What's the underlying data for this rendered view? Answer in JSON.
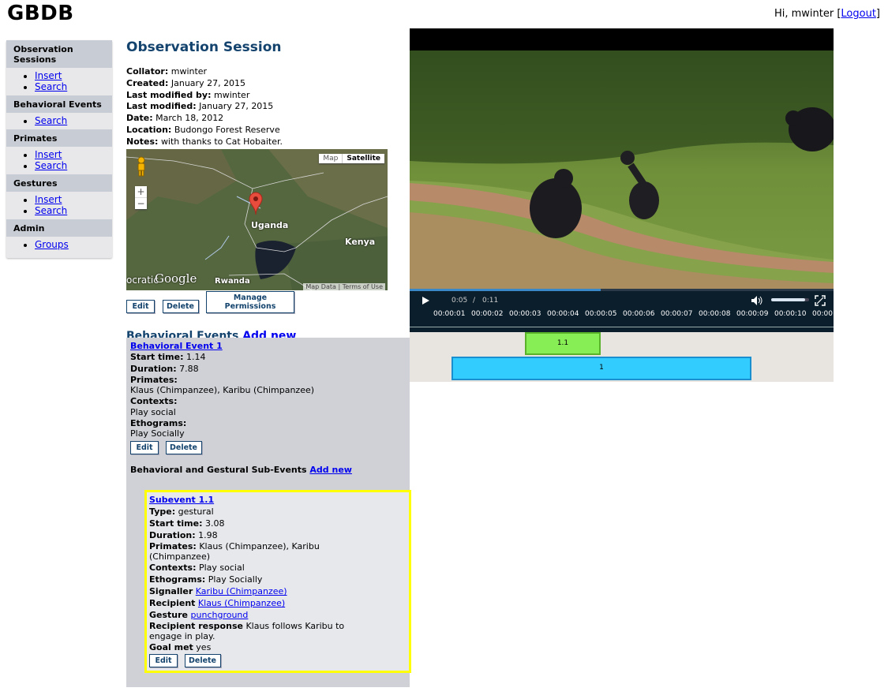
{
  "brand": "GBDB",
  "user": {
    "greeting": "Hi, mwinter [",
    "logout": "Logout",
    "close": "]"
  },
  "sidebar": {
    "sections": [
      {
        "title": "Observation Sessions",
        "items": [
          "Insert",
          "Search"
        ]
      },
      {
        "title": "Behavioral Events",
        "items": [
          "Search"
        ]
      },
      {
        "title": "Primates",
        "items": [
          "Insert",
          "Search"
        ]
      },
      {
        "title": "Gestures",
        "items": [
          "Insert",
          "Search"
        ]
      },
      {
        "title": "Admin",
        "items": [
          "Groups"
        ]
      }
    ]
  },
  "session": {
    "title": "Observation Session",
    "fields": [
      {
        "label": "Collator:",
        "value": "mwinter"
      },
      {
        "label": "Created:",
        "value": "January 27, 2015"
      },
      {
        "label": "Last modified by:",
        "value": "mwinter"
      },
      {
        "label": "Last modified:",
        "value": "January 27, 2015"
      },
      {
        "label": "Date:",
        "value": "March 18, 2012"
      },
      {
        "label": "Location:",
        "value": "Budongo Forest Reserve"
      },
      {
        "label": "Notes:",
        "value": "with thanks to Cat Hobaiter."
      }
    ],
    "map": {
      "type_map": "Map",
      "type_satellite": "Satellite",
      "zoom_in": "+",
      "zoom_out": "−",
      "label_uganda": "Uganda",
      "label_kenya": "Kenya",
      "label_rwanda": "Rwanda",
      "google": "Google",
      "google_prefix": "ocratic",
      "map_data": "Map Data",
      "terms": "Terms of Use"
    },
    "buttons": {
      "edit": "Edit",
      "delete": "Delete",
      "permissions": "Manage Permissions"
    }
  },
  "events": {
    "title": "Behavioral Events",
    "add_new": "Add new",
    "event": {
      "name": "Behavioral Event 1",
      "start_label": "Start time:",
      "start": "1.14",
      "duration_label": "Duration:",
      "duration": "7.88",
      "primates_label": "Primates:",
      "primates": "Klaus (Chimpanzee), Karibu (Chimpanzee)",
      "contexts_label": "Contexts:",
      "contexts": "Play social",
      "ethograms_label": "Ethograms:",
      "ethograms": "Play Socially",
      "edit": "Edit",
      "delete": "Delete"
    },
    "sub_title": "Behavioral and Gestural Sub-Events",
    "sub_add_new": "Add new",
    "subevent": {
      "name": "Subevent 1.1",
      "type_label": "Type:",
      "type": "gestural",
      "start_label": "Start time:",
      "start": "3.08",
      "duration_label": "Duration:",
      "duration": "1.98",
      "primates_label": "Primates:",
      "primates": "Klaus (Chimpanzee), Karibu (Chimpanzee)",
      "contexts_label": "Contexts:",
      "contexts": "Play social",
      "ethograms_label": "Ethograms:",
      "ethograms": "Play Socially",
      "signaller_label": "Signaller",
      "signaller": "Karibu (Chimpanzee)",
      "recipient_label": "Recipient",
      "recipient": "Klaus (Chimpanzee)",
      "gesture_label": "Gesture",
      "gesture": "punchground",
      "response_label": "Recipient response",
      "response": "Klaus follows Karibu to engage in play.",
      "goal_label": "Goal met",
      "goal": "yes",
      "edit": "Edit",
      "delete": "Delete"
    }
  },
  "video": {
    "current_time": "0:05",
    "separator": "/",
    "duration": "0:11",
    "progress": 0.45,
    "volume": 0.9,
    "ticks": [
      "00:00:01",
      "00:00:02",
      "00:00:03",
      "00:00:04",
      "00:00:05",
      "00:00:06",
      "00:00:07",
      "00:00:08",
      "00:00:09",
      "00:00:10",
      "00:00"
    ],
    "timeline": {
      "subevent_label": "1.1",
      "subevent_color": "#88ee55",
      "event_label": "1",
      "event_color": "#33ccff"
    }
  }
}
